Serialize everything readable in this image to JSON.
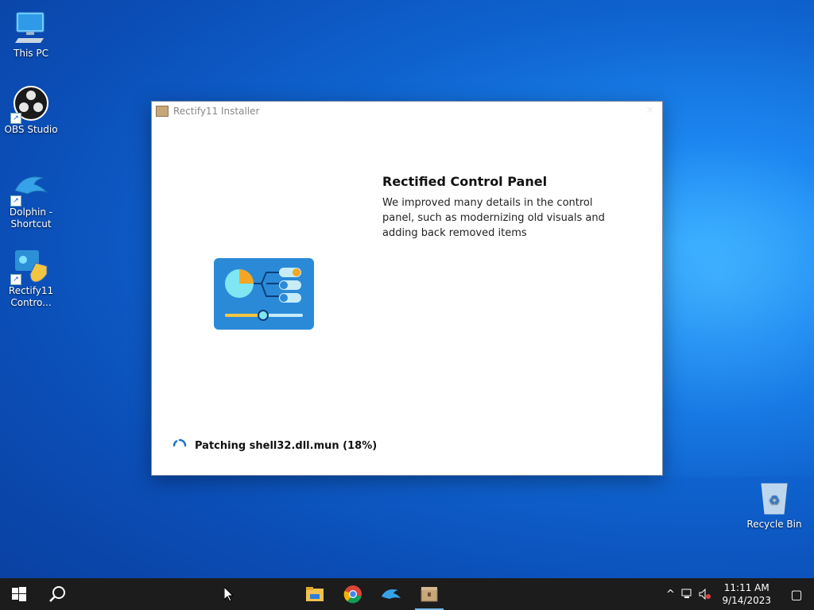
{
  "desktop": {
    "icons": [
      {
        "label": "This PC",
        "icon": "this-pc-icon"
      },
      {
        "label": "OBS Studio",
        "icon": "obs-icon"
      },
      {
        "label": "Dolphin - Shortcut",
        "icon": "dolphin-icon"
      },
      {
        "label": "Rectify11 Contro...",
        "icon": "rectify11-control-panel-icon"
      },
      {
        "label": "Recycle Bin",
        "icon": "recycle-bin-icon"
      }
    ]
  },
  "installer": {
    "title": "Rectify11 Installer",
    "close": "✕",
    "heading": "Rectified Control Panel",
    "description": "We improved many details in the control panel, such as modernizing old visuals and adding back removed items",
    "status": "Patching shell32.dll.mun (18%)"
  },
  "taskbar": {
    "apps": [
      "start-icon",
      "search-icon",
      "file-explorer-icon",
      "chrome-icon",
      "dolphin-icon",
      "rectify11-installer-icon"
    ],
    "time": "11:11 AM",
    "date": "9/14/2023",
    "tray": {
      "chevron": "^",
      "notifications": "▢"
    }
  }
}
